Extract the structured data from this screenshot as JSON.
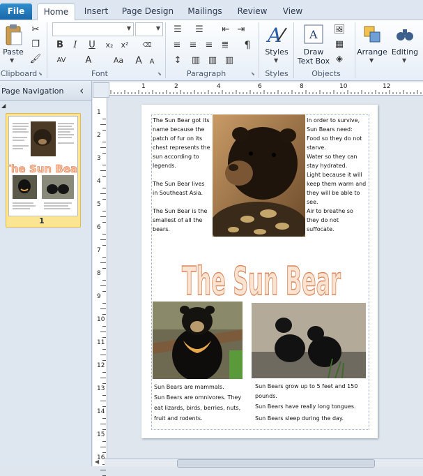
{
  "tabs": {
    "file": "File",
    "items": [
      "Home",
      "Insert",
      "Page Design",
      "Mailings",
      "Review",
      "View"
    ]
  },
  "ribbon": {
    "clipboard": {
      "paste": "Paste",
      "label": "Clipboard"
    },
    "font": {
      "label": "Font",
      "bold": "B",
      "italic": "I",
      "underline": "U",
      "subscript": "x₂",
      "superscript": "x²",
      "spacing": "AV",
      "case": "Aa",
      "grow": "A",
      "shrink": "A"
    },
    "paragraph": {
      "label": "Paragraph",
      "pilcrow": "¶"
    },
    "styles": {
      "button": "Styles",
      "label": "Styles"
    },
    "objects": {
      "draw_text_box": "Draw Text Box",
      "label": "Objects"
    },
    "arrange": {
      "button": "Arrange"
    },
    "editing": {
      "button": "Editing"
    }
  },
  "nav": {
    "title": "Page Navigation",
    "collapse": "‹",
    "page_number": "1"
  },
  "ruler": {
    "h": [
      "1",
      "2",
      "4",
      "6",
      "8",
      "10",
      "12"
    ],
    "v": [
      "1",
      "2",
      "3",
      "4",
      "5",
      "6",
      "7",
      "8",
      "9",
      "10",
      "11",
      "12",
      "13",
      "14",
      "15",
      "16"
    ]
  },
  "document": {
    "left_col": [
      "The Sun Bear got its name because the patch of fur on its chest represents the sun according to legends.",
      "The Sun Bear lives in Southeast Asia.",
      "The Sun Bear is the smallest of all the bears."
    ],
    "right_col": [
      "In order to survive, Sun Bears need:",
      "Food so they do not starve.",
      "Water so they can stay hydrated.",
      "Light because it will keep them warm and they will be able to see.",
      "Air to breathe so they do not suffocate."
    ],
    "title": "The Sun Bear",
    "bottom_left": [
      "Sun Bears are mammals.",
      "Sun Bears are omnivores. They eat lizards, birds, berries, nuts, fruit and rodents."
    ],
    "bottom_right": [
      "Sun Bears grow up to 5 feet and 150 pounds.",
      "Sun Bears have really long tongues.",
      "Sun Bears sleep during the day."
    ]
  },
  "colors": {
    "title_fill": "#fbe3d2",
    "title_stroke": "#d9875a"
  }
}
